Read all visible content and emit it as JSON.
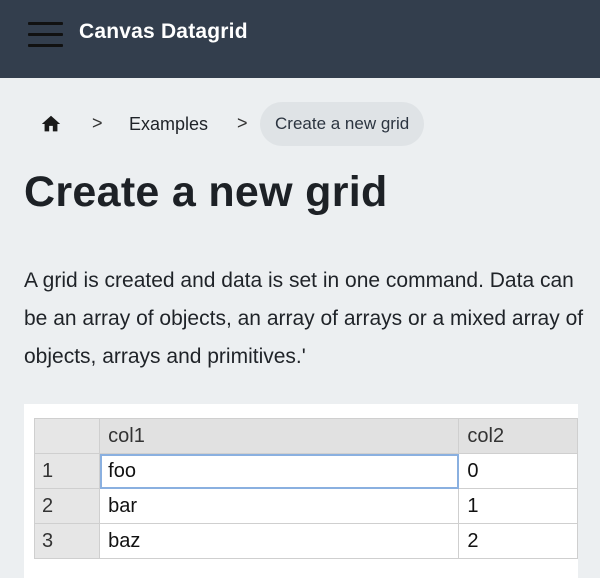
{
  "app": {
    "title": "Canvas Datagrid"
  },
  "icons": {
    "menu": "hamburger-menu-icon",
    "home": "home-icon",
    "separator": "chevron-right-icon"
  },
  "colors": {
    "appbar": "#333e4d",
    "background": "#eceff1",
    "selection": "#8ab0e0"
  },
  "breadcrumb": {
    "separator": ">",
    "items": [
      {
        "label": "Examples"
      }
    ],
    "current": "Create a new grid"
  },
  "page": {
    "title": "Create a new grid",
    "description": "A grid is created and data is set in one command. Data can be an array of objects, an array of arrays or a mixed array of objects, arrays and primitives.'"
  },
  "grid": {
    "columns": [
      "col1",
      "col2"
    ],
    "rows": [
      {
        "index": "1",
        "cells": [
          "foo",
          "0"
        ]
      },
      {
        "index": "2",
        "cells": [
          "bar",
          "1"
        ]
      },
      {
        "index": "3",
        "cells": [
          "baz",
          "2"
        ]
      }
    ],
    "selected_cell": {
      "row": 0,
      "col": 0
    }
  }
}
